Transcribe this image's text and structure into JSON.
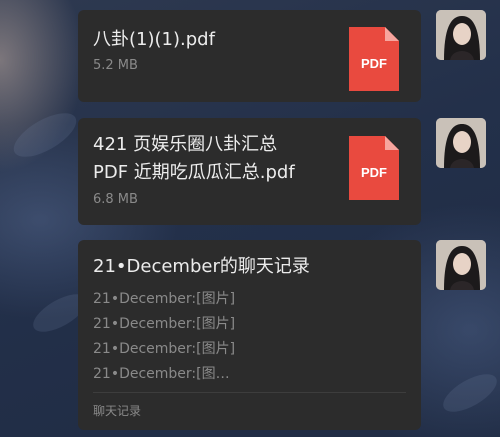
{
  "messages": [
    {
      "type": "file",
      "title_lines": [
        "八卦(1)(1).pdf"
      ],
      "size": "5.2 MB",
      "file_icon_label": "PDF"
    },
    {
      "type": "file",
      "title_lines": [
        "421 页娱乐圈八卦汇总",
        "PDF 近期吃瓜瓜汇总.pdf"
      ],
      "size": "6.8 MB",
      "file_icon_label": "PDF"
    },
    {
      "type": "chat_record",
      "title": "21•December的聊天记录",
      "lines": [
        "21•December:[图片]",
        "21•December:[图片]",
        "21•December:[图片]",
        "21•December:[图…"
      ],
      "footer": "聊天记录"
    }
  ],
  "colors": {
    "bubble": "#2c2c2c",
    "pdf_red": "#e94a3f",
    "title_text": "#ececec",
    "secondary_text": "#8a8a8a"
  },
  "icons": [
    "pdf-file-icon",
    "avatar"
  ]
}
